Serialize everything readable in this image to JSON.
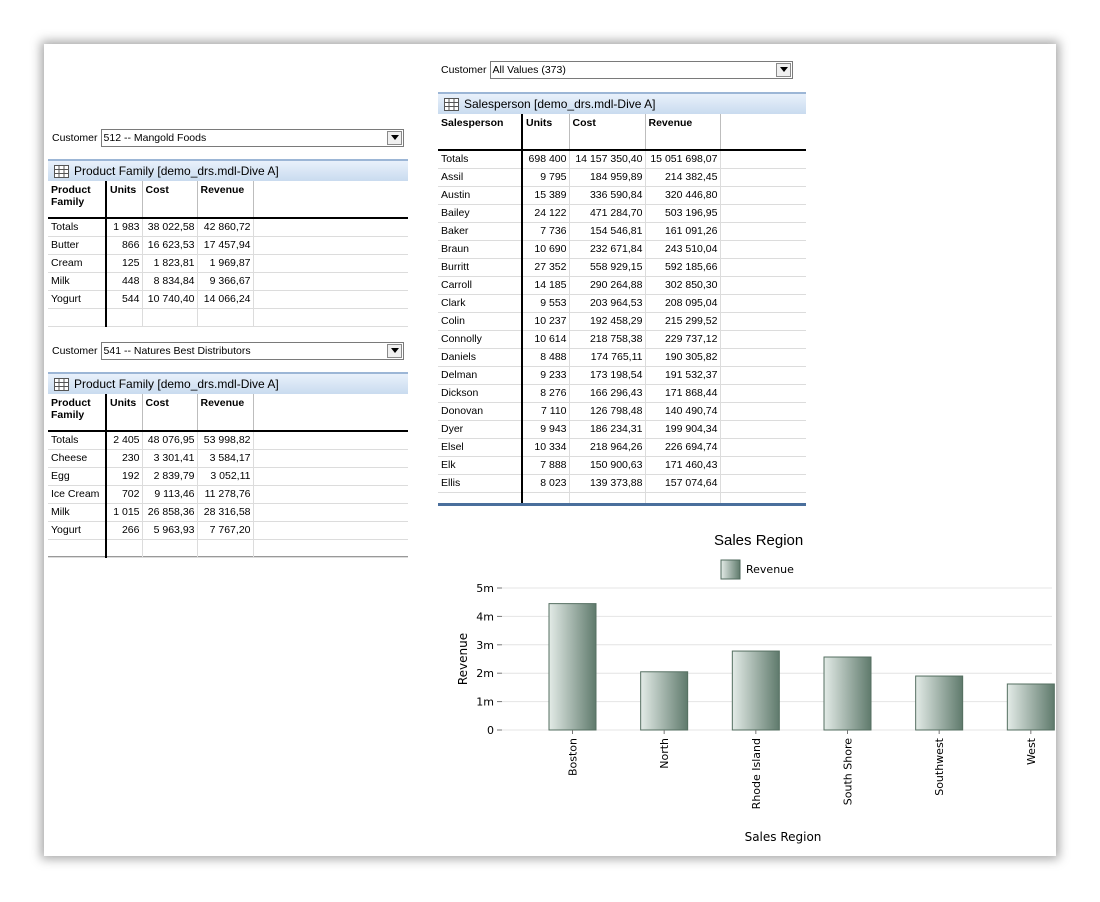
{
  "customer_label": "Customer",
  "panel_a": {
    "customer_value": "512 -- Mangold Foods",
    "title": "Product Family [demo_drs.mdl-Dive A]",
    "columns": [
      "Product Family",
      "Units",
      "Cost",
      "Revenue"
    ],
    "rows": [
      [
        "Totals",
        "1 983",
        "38 022,58",
        "42 860,72"
      ],
      [
        "Butter",
        "866",
        "16 623,53",
        "17 457,94"
      ],
      [
        "Cream",
        "125",
        "1 823,81",
        "1 969,87"
      ],
      [
        "Milk",
        "448",
        "8 834,84",
        "9 366,67"
      ],
      [
        "Yogurt",
        "544",
        "10 740,40",
        "14 066,24"
      ]
    ]
  },
  "panel_b": {
    "customer_value": "541 -- Natures Best Distributors",
    "title": "Product Family [demo_drs.mdl-Dive A]",
    "columns": [
      "Product Family",
      "Units",
      "Cost",
      "Revenue"
    ],
    "rows": [
      [
        "Totals",
        "2 405",
        "48 076,95",
        "53 998,82"
      ],
      [
        "Cheese",
        "230",
        "3 301,41",
        "3 584,17"
      ],
      [
        "Egg",
        "192",
        "2 839,79",
        "3 052,11"
      ],
      [
        "Ice Cream",
        "702",
        "9 113,46",
        "11 278,76"
      ],
      [
        "Milk",
        "1 015",
        "26 858,36",
        "28 316,58"
      ],
      [
        "Yogurt",
        "266",
        "5 963,93",
        "7 767,20"
      ]
    ]
  },
  "panel_c": {
    "customer_value": "All Values (373)",
    "title": "Salesperson [demo_drs.mdl-Dive A]",
    "columns": [
      "Salesperson",
      "Units",
      "Cost",
      "Revenue"
    ],
    "rows": [
      [
        "Totals",
        "698 400",
        "14 157 350,40",
        "15 051 698,07"
      ],
      [
        "Assil",
        "9 795",
        "184 959,89",
        "214 382,45"
      ],
      [
        "Austin",
        "15 389",
        "336 590,84",
        "320 446,80"
      ],
      [
        "Bailey",
        "24 122",
        "471 284,70",
        "503 196,95"
      ],
      [
        "Baker",
        "7 736",
        "154 546,81",
        "161 091,26"
      ],
      [
        "Braun",
        "10 690",
        "232 671,84",
        "243 510,04"
      ],
      [
        "Burritt",
        "27 352",
        "558 929,15",
        "592 185,66"
      ],
      [
        "Carroll",
        "14 185",
        "290 264,88",
        "302 850,30"
      ],
      [
        "Clark",
        "9 553",
        "203 964,53",
        "208 095,04"
      ],
      [
        "Colin",
        "10 237",
        "192 458,29",
        "215 299,52"
      ],
      [
        "Connolly",
        "10 614",
        "218 758,38",
        "229 737,12"
      ],
      [
        "Daniels",
        "8 488",
        "174 765,11",
        "190 305,82"
      ],
      [
        "Delman",
        "9 233",
        "173 198,54",
        "191 532,37"
      ],
      [
        "Dickson",
        "8 276",
        "166 296,43",
        "171 868,44"
      ],
      [
        "Donovan",
        "7 110",
        "126 798,48",
        "140 490,74"
      ],
      [
        "Dyer",
        "9 943",
        "186 234,31",
        "199 904,34"
      ],
      [
        "Elsel",
        "10 334",
        "218 964,26",
        "226 694,74"
      ],
      [
        "Elk",
        "7 888",
        "150 900,63",
        "171 460,43"
      ],
      [
        "Ellis",
        "8 023",
        "139 373,88",
        "157 074,64"
      ]
    ]
  },
  "chart_data": {
    "type": "bar",
    "title": "Sales Region",
    "xlabel": "Sales Region",
    "ylabel": "Revenue",
    "categories": [
      "Boston",
      "North",
      "Rhode Island",
      "South Shore",
      "Southwest",
      "West"
    ],
    "series": [
      {
        "name": "Revenue",
        "values": [
          4.45,
          2.05,
          2.78,
          2.57,
          1.9,
          1.62
        ]
      }
    ],
    "ylim": [
      0,
      5
    ],
    "yticks": [
      "0",
      "1m",
      "2m",
      "3m",
      "4m",
      "5m"
    ],
    "grid": true,
    "legend": "top",
    "colors": {
      "bar_light": "#e3ebe7",
      "bar_dark": "#5f7a6c"
    }
  }
}
